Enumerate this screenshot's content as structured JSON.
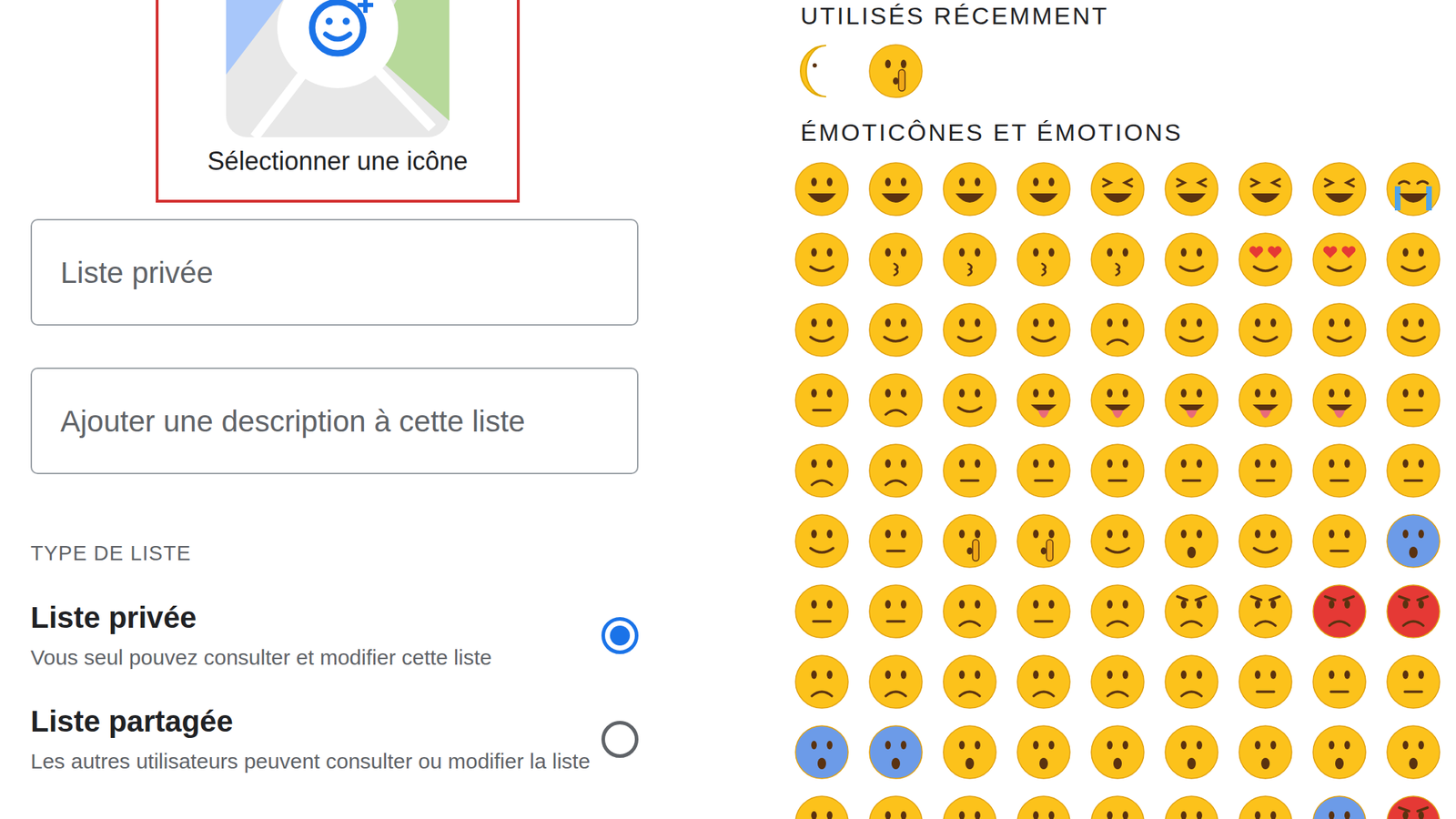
{
  "left": {
    "icon_picker": {
      "label": "Sélectionner une icône"
    },
    "name_field": {
      "placeholder": "Liste privée"
    },
    "description_field": {
      "placeholder": "Ajouter une description à cette liste"
    },
    "list_type": {
      "heading": "TYPE DE LISTE",
      "options": [
        {
          "title": "Liste privée",
          "description": "Vous seul pouvez consulter et modifier cette liste",
          "selected": true
        },
        {
          "title": "Liste partagée",
          "description": "Les autres utilisateurs peuvent consulter ou modifier la liste",
          "selected": false
        }
      ]
    }
  },
  "right": {
    "recent": {
      "heading": "UTILISÉS RÉCEMMENT",
      "items": [
        {
          "kind": "moon",
          "color": "#fcc21b"
        },
        {
          "kind": "shush",
          "color": "#fcc21b"
        }
      ]
    },
    "section": {
      "heading": "ÉMOTICÔNES ET ÉMOTIONS",
      "rows": [
        [
          {
            "kind": "grin",
            "color": "#fcc21b"
          },
          {
            "kind": "grin",
            "color": "#fcc21b"
          },
          {
            "kind": "grin",
            "color": "#fcc21b"
          },
          {
            "kind": "grin",
            "color": "#fcc21b"
          },
          {
            "kind": "laugh",
            "color": "#fcc21b"
          },
          {
            "kind": "laugh",
            "color": "#fcc21b"
          },
          {
            "kind": "laugh",
            "color": "#fcc21b"
          },
          {
            "kind": "laugh",
            "color": "#fcc21b"
          },
          {
            "kind": "cry",
            "color": "#fcc21b"
          }
        ],
        [
          {
            "kind": "smile",
            "color": "#fcc21b"
          },
          {
            "kind": "kiss",
            "color": "#fcc21b"
          },
          {
            "kind": "kiss",
            "color": "#fcc21b"
          },
          {
            "kind": "kiss",
            "color": "#fcc21b"
          },
          {
            "kind": "kiss",
            "color": "#fcc21b"
          },
          {
            "kind": "smile",
            "color": "#fcc21b"
          },
          {
            "kind": "hearteyes",
            "color": "#fcc21b"
          },
          {
            "kind": "hearteyes",
            "color": "#fcc21b"
          },
          {
            "kind": "smile",
            "color": "#fcc21b"
          }
        ],
        [
          {
            "kind": "smile",
            "color": "#fcc21b"
          },
          {
            "kind": "smile",
            "color": "#fcc21b"
          },
          {
            "kind": "smile",
            "color": "#fcc21b"
          },
          {
            "kind": "smile",
            "color": "#fcc21b"
          },
          {
            "kind": "sad",
            "color": "#fcc21b"
          },
          {
            "kind": "smile",
            "color": "#fcc21b"
          },
          {
            "kind": "smile",
            "color": "#fcc21b"
          },
          {
            "kind": "smile",
            "color": "#fcc21b"
          },
          {
            "kind": "smile",
            "color": "#fcc21b"
          }
        ],
        [
          {
            "kind": "neutral",
            "color": "#fcc21b"
          },
          {
            "kind": "sad",
            "color": "#fcc21b"
          },
          {
            "kind": "smile",
            "color": "#fcc21b"
          },
          {
            "kind": "tongue",
            "color": "#fcc21b"
          },
          {
            "kind": "tongue",
            "color": "#fcc21b"
          },
          {
            "kind": "tongue",
            "color": "#fcc21b"
          },
          {
            "kind": "tongue",
            "color": "#fcc21b"
          },
          {
            "kind": "tongue",
            "color": "#fcc21b"
          },
          {
            "kind": "neutral",
            "color": "#fcc21b"
          }
        ],
        [
          {
            "kind": "sad",
            "color": "#fcc21b"
          },
          {
            "kind": "sad",
            "color": "#fcc21b"
          },
          {
            "kind": "neutral",
            "color": "#fcc21b"
          },
          {
            "kind": "neutral",
            "color": "#fcc21b"
          },
          {
            "kind": "neutral",
            "color": "#fcc21b"
          },
          {
            "kind": "neutral",
            "color": "#fcc21b"
          },
          {
            "kind": "neutral",
            "color": "#fcc21b"
          },
          {
            "kind": "neutral",
            "color": "#fcc21b"
          },
          {
            "kind": "neutral",
            "color": "#fcc21b"
          }
        ],
        [
          {
            "kind": "smile",
            "color": "#fcc21b"
          },
          {
            "kind": "neutral",
            "color": "#fcc21b"
          },
          {
            "kind": "shush",
            "color": "#fcc21b"
          },
          {
            "kind": "shush",
            "color": "#fcc21b"
          },
          {
            "kind": "smile",
            "color": "#fcc21b"
          },
          {
            "kind": "open",
            "color": "#fcc21b"
          },
          {
            "kind": "smile",
            "color": "#fcc21b"
          },
          {
            "kind": "neutral",
            "color": "#fcc21b"
          },
          {
            "kind": "open",
            "color": "#6c9be8"
          }
        ],
        [
          {
            "kind": "neutral",
            "color": "#fcc21b"
          },
          {
            "kind": "neutral",
            "color": "#fcc21b"
          },
          {
            "kind": "sad",
            "color": "#fcc21b"
          },
          {
            "kind": "neutral",
            "color": "#fcc21b"
          },
          {
            "kind": "sad",
            "color": "#fcc21b"
          },
          {
            "kind": "angry",
            "color": "#fcc21b"
          },
          {
            "kind": "angry",
            "color": "#fcc21b"
          },
          {
            "kind": "angry",
            "color": "#e53935"
          },
          {
            "kind": "angry",
            "color": "#e53935"
          }
        ],
        [
          {
            "kind": "sad",
            "color": "#fcc21b"
          },
          {
            "kind": "sad",
            "color": "#fcc21b"
          },
          {
            "kind": "sad",
            "color": "#fcc21b"
          },
          {
            "kind": "sad",
            "color": "#fcc21b"
          },
          {
            "kind": "sad",
            "color": "#fcc21b"
          },
          {
            "kind": "sad",
            "color": "#fcc21b"
          },
          {
            "kind": "neutral",
            "color": "#fcc21b"
          },
          {
            "kind": "neutral",
            "color": "#fcc21b"
          },
          {
            "kind": "neutral",
            "color": "#fcc21b"
          }
        ],
        [
          {
            "kind": "open",
            "color": "#6c9be8"
          },
          {
            "kind": "open",
            "color": "#6c9be8"
          },
          {
            "kind": "open",
            "color": "#fcc21b"
          },
          {
            "kind": "open",
            "color": "#fcc21b"
          },
          {
            "kind": "open",
            "color": "#fcc21b"
          },
          {
            "kind": "open",
            "color": "#fcc21b"
          },
          {
            "kind": "open",
            "color": "#fcc21b"
          },
          {
            "kind": "open",
            "color": "#fcc21b"
          },
          {
            "kind": "open",
            "color": "#fcc21b"
          }
        ],
        [
          {
            "kind": "sad",
            "color": "#fcc21b"
          },
          {
            "kind": "sad",
            "color": "#fcc21b"
          },
          {
            "kind": "sad",
            "color": "#fcc21b"
          },
          {
            "kind": "sad",
            "color": "#fcc21b"
          },
          {
            "kind": "sad",
            "color": "#fcc21b"
          },
          {
            "kind": "sad",
            "color": "#fcc21b"
          },
          {
            "kind": "sad",
            "color": "#fcc21b"
          },
          {
            "kind": "open",
            "color": "#6c9be8"
          },
          {
            "kind": "angry",
            "color": "#e53935"
          }
        ]
      ]
    }
  }
}
